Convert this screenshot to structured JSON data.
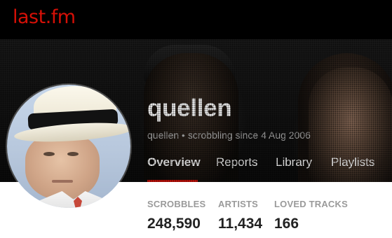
{
  "header": {
    "logo_text": "last.fm",
    "brand_color": "#d51007"
  },
  "profile": {
    "username": "quellen",
    "subline": "quellen • scrobbling since 4 Aug 2006",
    "avatar": "user-avatar-photo"
  },
  "nav": {
    "tabs": [
      {
        "label": "Overview",
        "active": true
      },
      {
        "label": "Reports",
        "active": false
      },
      {
        "label": "Library",
        "active": false
      },
      {
        "label": "Playlists",
        "active": false
      }
    ],
    "active_color": "#d51007"
  },
  "stats": [
    {
      "label": "SCROBBLES",
      "value": "248,590"
    },
    {
      "label": "ARTISTS",
      "value": "11,434"
    },
    {
      "label": "LOVED TRACKS",
      "value": "166"
    }
  ]
}
